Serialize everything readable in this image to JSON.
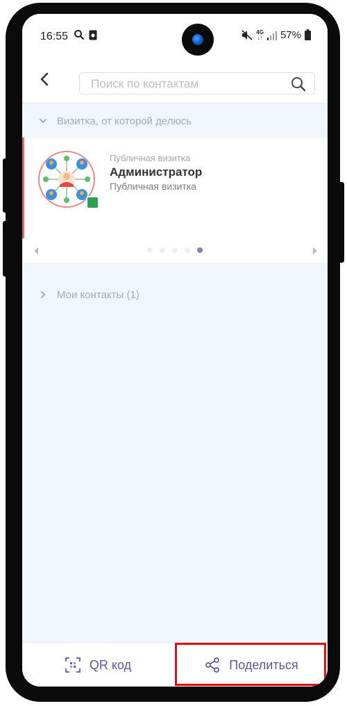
{
  "status_bar": {
    "time": "16:55",
    "network": "4G",
    "battery": "57%"
  },
  "header": {
    "search_placeholder": "Поиск по контактам"
  },
  "shared_card_section": {
    "title": "Визитка, от которой делюсь",
    "card": {
      "subtitle": "Публичная визитка",
      "name": "Администратор",
      "description": "Публичная визитка"
    },
    "carousel": {
      "dot_count": 5,
      "active_index": 4
    }
  },
  "contacts_section": {
    "title": "Мои контакты (1)"
  },
  "bottom_bar": {
    "qr_label": "QR код",
    "share_label": "Поделиться"
  },
  "colors": {
    "accent": "#5a5a9a",
    "card_accent": "#e06a6a",
    "highlight": "#e01010"
  }
}
